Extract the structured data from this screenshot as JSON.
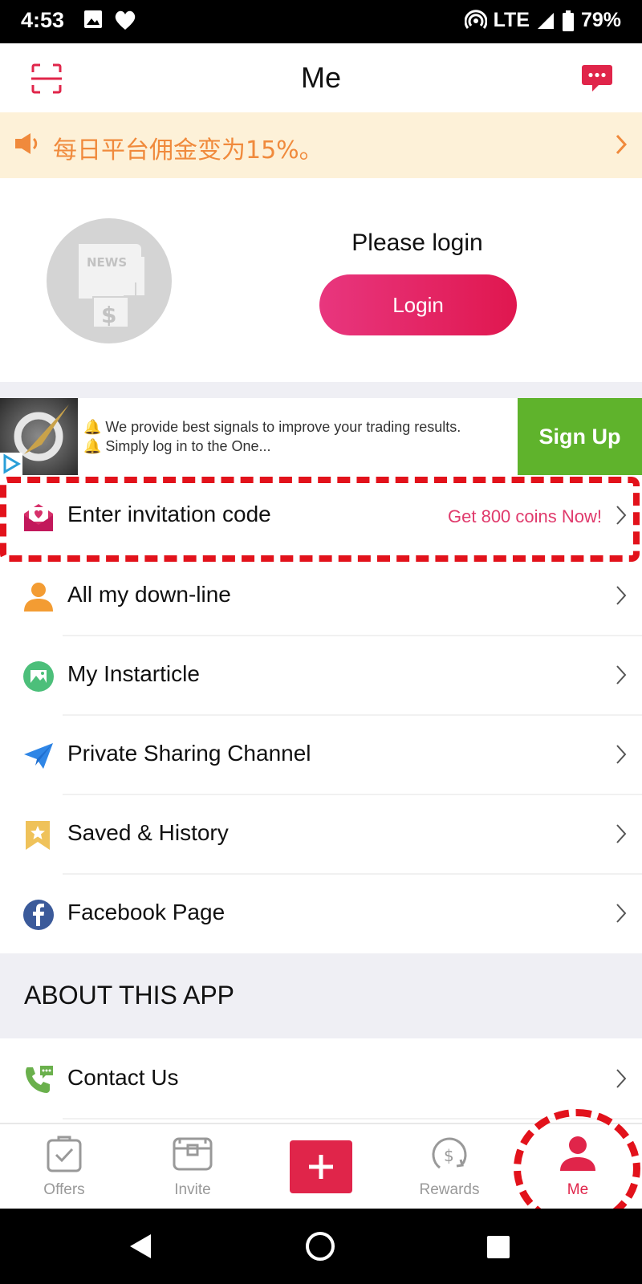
{
  "status_bar": {
    "time": "4:53",
    "network": "LTE",
    "battery": "79%"
  },
  "header": {
    "title": "Me"
  },
  "notice": {
    "text": "每日平台佣金变为15%。"
  },
  "profile": {
    "please_login": "Please login",
    "login_button": "Login"
  },
  "ad": {
    "line1": "🔔 We provide best signals to improve your trading results.",
    "line2": "🔔 Simply log in to the One...",
    "cta": "Sign Up"
  },
  "menu": {
    "invitation": {
      "label": "Enter invitation code",
      "promo": "Get 800 coins Now!"
    },
    "downline": {
      "label": "All my down-line"
    },
    "instarticle": {
      "label": "My Instarticle"
    },
    "sharing": {
      "label": "Private Sharing Channel"
    },
    "saved": {
      "label": "Saved & History"
    },
    "facebook": {
      "label": "Facebook Page"
    },
    "contact": {
      "label": "Contact Us"
    }
  },
  "about": {
    "title": "ABOUT THIS APP"
  },
  "bottom_nav": {
    "offers": "Offers",
    "invite": "Invite",
    "rewards": "Rewards",
    "me": "Me"
  },
  "colors": {
    "accent": "#e0254a",
    "notice_bg": "#fdf1d8",
    "notice_text": "#f08a3c",
    "signup_green": "#5fb32c",
    "highlight_red": "#e2121b"
  }
}
